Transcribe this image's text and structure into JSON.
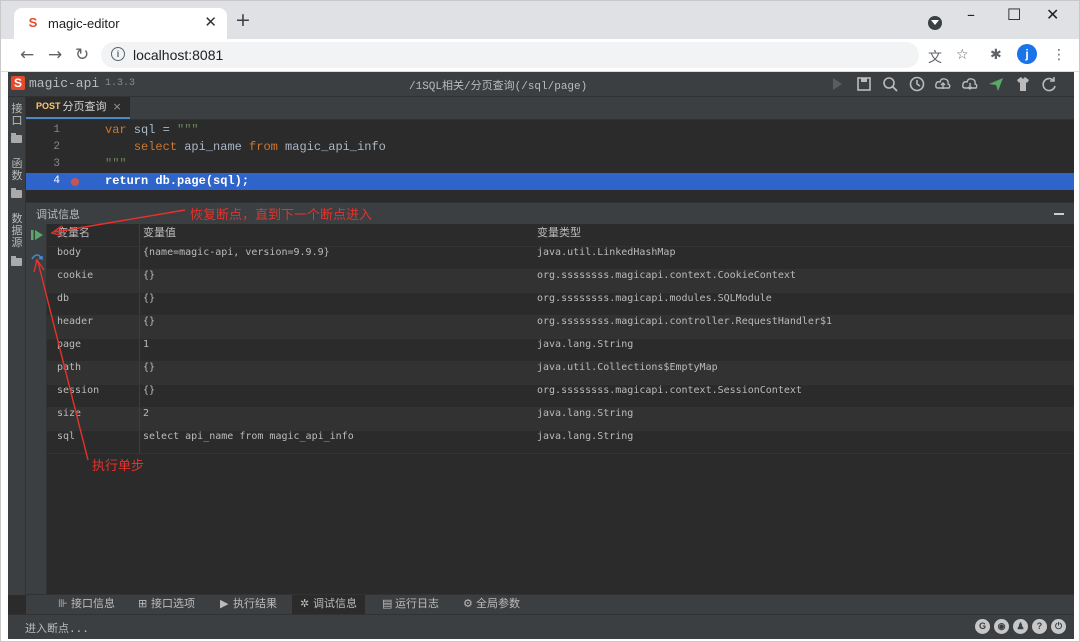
{
  "browser": {
    "tab_title": "magic-editor",
    "new_tab": "+",
    "url": "localhost:8081",
    "profile_initial": "j",
    "window_controls": [
      "–",
      "☐",
      "✕"
    ]
  },
  "app": {
    "name": "magic-api",
    "version": "1.3.3",
    "breadcrumb": "/1SQL相关/分页查询(/sql/page)",
    "header_icons": [
      "run-icon",
      "save-icon",
      "search-icon",
      "history-icon",
      "upload-icon",
      "download-icon",
      "push-icon",
      "skin-icon",
      "refresh-icon"
    ],
    "sidebar": [
      {
        "label": "接口",
        "icon": "folder-icon"
      },
      {
        "label": "函数",
        "icon": "folder-icon"
      },
      {
        "label": "数据源",
        "icon": "folder-icon"
      }
    ],
    "editor_tab": {
      "method": "POST",
      "name": "分页查询",
      "close": "×"
    },
    "code_lines": [
      {
        "num": "1",
        "text": "var sql = \"\"\""
      },
      {
        "num": "2",
        "text": "    select api_name from magic_api_info"
      },
      {
        "num": "3",
        "text": "\"\"\""
      },
      {
        "num": "4",
        "text": "return db.page(sql);",
        "breakpoint": true,
        "highlighted": true
      }
    ],
    "debug_panel": {
      "title": "调试信息",
      "columns": [
        "变量名",
        "变量值",
        "变量类型"
      ],
      "rows": [
        {
          "name": "body",
          "value": "{name=magic-api, version=9.9.9}",
          "type": "java.util.LinkedHashMap"
        },
        {
          "name": "cookie",
          "value": "{}",
          "type": "org.ssssssss.magicapi.context.CookieContext"
        },
        {
          "name": "db",
          "value": "{}",
          "type": "org.ssssssss.magicapi.modules.SQLModule"
        },
        {
          "name": "header",
          "value": "{}",
          "type": "org.ssssssss.magicapi.controller.RequestHandler$1"
        },
        {
          "name": "page",
          "value": "1",
          "type": "java.lang.String"
        },
        {
          "name": "path",
          "value": "{}",
          "type": "java.util.Collections$EmptyMap"
        },
        {
          "name": "session",
          "value": "{}",
          "type": "org.ssssssss.magicapi.context.SessionContext"
        },
        {
          "name": "size",
          "value": "2",
          "type": "java.lang.String"
        },
        {
          "name": "sql",
          "value": "select api_name from magic_api_info",
          "type": "java.lang.String"
        }
      ]
    },
    "bottom_tabs": [
      {
        "label": "接口信息",
        "icon": "info-icon"
      },
      {
        "label": "接口选项",
        "icon": "options-icon"
      },
      {
        "label": "执行结果",
        "icon": "play-icon"
      },
      {
        "label": "调试信息",
        "icon": "bug-icon",
        "active": true
      },
      {
        "label": "运行日志",
        "icon": "log-icon"
      },
      {
        "label": "全局参数",
        "icon": "gear-icon"
      }
    ],
    "status_text": "进入断点...",
    "status_icons": [
      "gitee-icon",
      "github-icon",
      "qq-icon",
      "help-icon",
      "power-icon"
    ]
  },
  "annotations": {
    "resume": "恢复断点，直到下一个断点进入",
    "step": "执行单步"
  },
  "colors": {
    "highlight_line": "#2f65ca",
    "annotation": "#e8312a",
    "breakpoint": "#c75450",
    "keyword": "#cc7832",
    "resume_green": "#59a869",
    "step_blue": "#4a88c7"
  }
}
